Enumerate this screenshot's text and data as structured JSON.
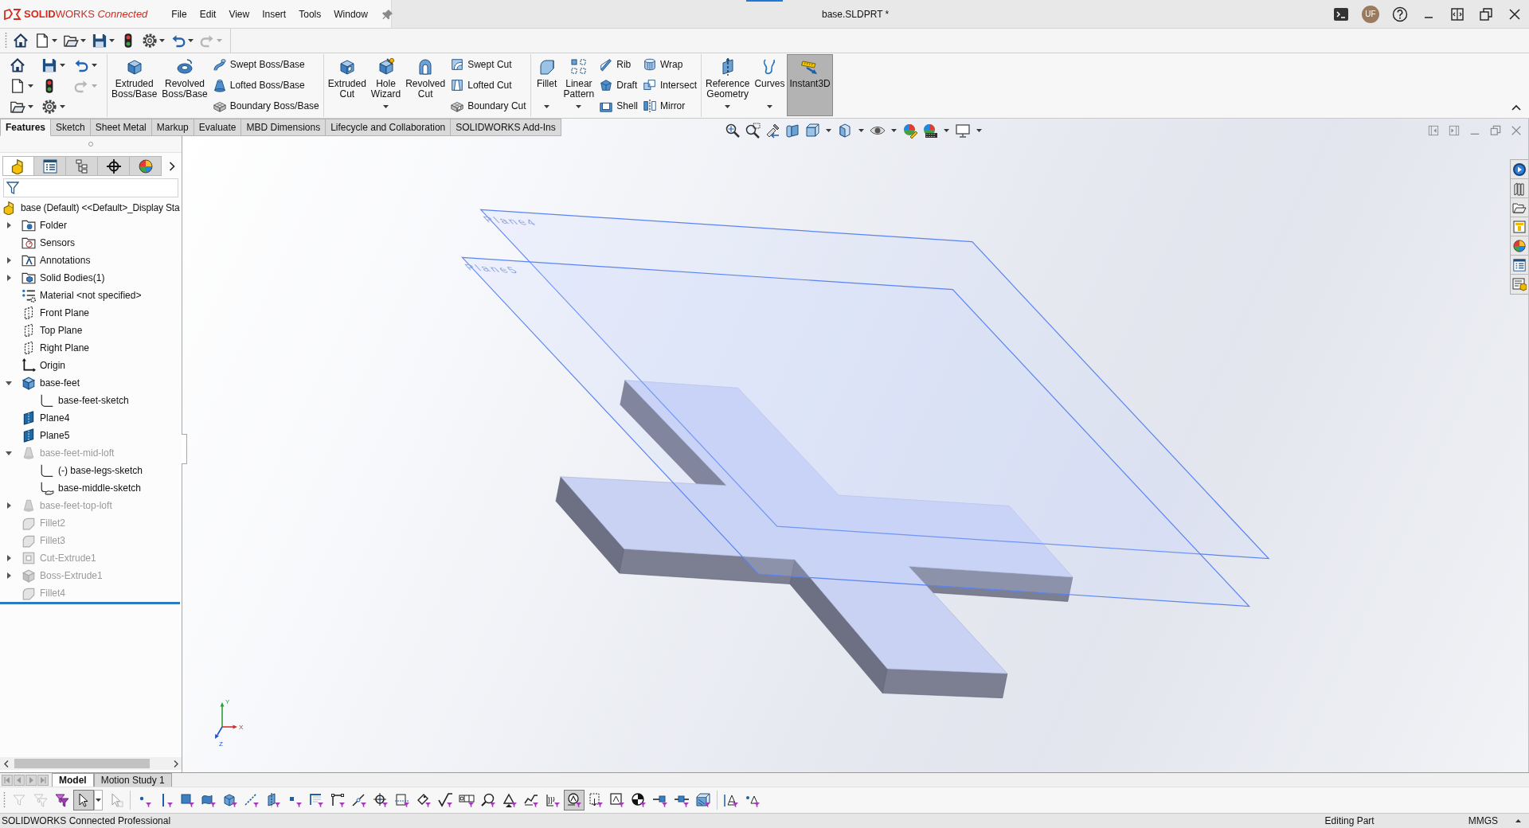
{
  "title_bar": {
    "brand": "**SOLID**WORKS *Connected*",
    "menus": [
      "File",
      "Edit",
      "View",
      "Insert",
      "Tools",
      "Window"
    ],
    "document": "base.SLDPRT *",
    "user_initials": "UF"
  },
  "quick_access_toolbar": [
    {
      "disabled": false
    },
    {
      "disabled": false
    },
    {
      "disabled": false
    },
    {
      "disabled": false
    },
    {
      "disabled": false
    },
    {
      "disabled": false
    },
    {
      "disabled": false
    },
    {
      "disabled": true
    }
  ],
  "command_manager": {
    "quick_tools": [
      {
        "disabled": false
      },
      {
        "disabled": false
      },
      {
        "disabled": false
      },
      {
        "disabled": false
      },
      {
        "disabled": false
      },
      {
        "disabled": true
      },
      {
        "disabled": false
      },
      {
        "disabled": false
      }
    ],
    "groups": [
      {
        "items": [
          {
            "kind": "large",
            "label": "Extruded Boss/Base",
            "dropdown": false,
            "selected": false
          },
          {
            "kind": "large",
            "label": "Revolved Boss/Base",
            "dropdown": false,
            "selected": false
          },
          {
            "kind": "stack",
            "buttons": [
              {
                "label": "Swept Boss/Base"
              },
              {
                "label": "Lofted Boss/Base"
              },
              {
                "label": "Boundary Boss/Base"
              }
            ]
          }
        ]
      },
      {
        "items": [
          {
            "kind": "large",
            "label": "Extruded Cut",
            "dropdown": false,
            "selected": false
          },
          {
            "kind": "large",
            "label": "Hole Wizard",
            "dropdown": true,
            "selected": false
          },
          {
            "kind": "large",
            "label": "Revolved Cut",
            "dropdown": false,
            "selected": false
          },
          {
            "kind": "stack",
            "buttons": [
              {
                "label": "Swept Cut"
              },
              {
                "label": "Lofted Cut"
              },
              {
                "label": "Boundary Cut"
              }
            ]
          }
        ]
      },
      {
        "items": [
          {
            "kind": "large",
            "label": "Fillet",
            "dropdown": true,
            "selected": false
          },
          {
            "kind": "large",
            "label": "Linear Pattern",
            "dropdown": true,
            "selected": false
          },
          {
            "kind": "stack",
            "buttons": [
              {
                "label": "Rib"
              },
              {
                "label": "Draft"
              },
              {
                "label": "Shell"
              }
            ]
          },
          {
            "kind": "stack",
            "buttons": [
              {
                "label": "Wrap"
              },
              {
                "label": "Intersect"
              },
              {
                "label": "Mirror"
              }
            ]
          }
        ]
      },
      {
        "items": [
          {
            "kind": "large",
            "label": "Reference Geometry",
            "dropdown": true,
            "selected": false
          },
          {
            "kind": "large",
            "label": "Curves",
            "dropdown": true,
            "selected": false
          },
          {
            "kind": "large",
            "label": "Instant3D",
            "dropdown": false,
            "selected": true
          }
        ]
      }
    ]
  },
  "command_tabs": [
    {
      "label": "Features",
      "selected": true
    },
    {
      "label": "Sketch",
      "selected": false
    },
    {
      "label": "Sheet Metal",
      "selected": false
    },
    {
      "label": "Markup",
      "selected": false
    },
    {
      "label": "Evaluate",
      "selected": false
    },
    {
      "label": "MBD Dimensions",
      "selected": false
    },
    {
      "label": "Lifecycle and Collaboration",
      "selected": false
    },
    {
      "label": "SOLIDWORKS Add-Ins",
      "selected": false
    }
  ],
  "feature_manager": {
    "tabs": [
      {
        "selected": true
      },
      {
        "selected": false
      },
      {
        "selected": false
      },
      {
        "selected": false
      },
      {
        "selected": false
      }
    ],
    "tree": {
      "root": {
        "label": "base (Default) <<Default>_Display Sta",
        "kind": "part"
      },
      "items": [
        {
          "label": "Folder",
          "kind": "folder",
          "expanded": false,
          "suppressed": false
        },
        {
          "label": "Sensors",
          "kind": "sensors",
          "suppressed": false
        },
        {
          "label": "Annotations",
          "kind": "annotations",
          "expanded": false,
          "suppressed": false
        },
        {
          "label": "Solid Bodies(1)",
          "kind": "bodies",
          "expanded": false,
          "suppressed": false
        },
        {
          "label": "Material <not specified>",
          "kind": "material",
          "suppressed": false
        },
        {
          "label": "Front Plane",
          "kind": "plane",
          "suppressed": false
        },
        {
          "label": "Top Plane",
          "kind": "plane",
          "suppressed": false
        },
        {
          "label": "Right Plane",
          "kind": "plane",
          "suppressed": false
        },
        {
          "label": "Origin",
          "kind": "origin",
          "suppressed": false
        },
        {
          "label": "base-feet",
          "kind": "extrude",
          "expanded": true,
          "suppressed": false,
          "children": [
            {
              "label": "base-feet-sketch",
              "kind": "sketch",
              "suppressed": false
            }
          ]
        },
        {
          "label": "Plane4",
          "kind": "ref_plane",
          "suppressed": false
        },
        {
          "label": "Plane5",
          "kind": "ref_plane",
          "suppressed": false
        },
        {
          "label": "base-feet-mid-loft",
          "kind": "loft",
          "expanded": true,
          "suppressed": true,
          "children": [
            {
              "label": "(-) base-legs-sketch",
              "kind": "sketch",
              "suppressed": false
            },
            {
              "label": "base-middle-sketch",
              "kind": "shared_sketch",
              "suppressed": false
            }
          ]
        },
        {
          "label": "base-feet-top-loft",
          "kind": "loft",
          "expanded": false,
          "suppressed": true
        },
        {
          "label": "Fillet2",
          "kind": "fillet",
          "suppressed": true
        },
        {
          "label": "Fillet3",
          "kind": "fillet",
          "suppressed": true
        },
        {
          "label": "Cut-Extrude1",
          "kind": "cut",
          "expanded": false,
          "suppressed": true
        },
        {
          "label": "Boss-Extrude1",
          "kind": "extrude",
          "expanded": false,
          "suppressed": true
        },
        {
          "label": "Fillet4",
          "kind": "fillet",
          "suppressed": true
        }
      ]
    }
  },
  "graphics": {
    "planes": [
      {
        "label": "Plane4"
      },
      {
        "label": "Plane5"
      }
    ],
    "triad": {
      "x": "X",
      "y": "Y",
      "z": "Z"
    }
  },
  "study_tabs": [
    {
      "label": "Model",
      "selected": true
    },
    {
      "label": "Motion Study 1",
      "selected": false
    }
  ],
  "selection_filter": [
    {
      "disabled": true,
      "selected": false
    },
    {
      "disabled": true,
      "selected": false
    },
    {
      "disabled": false,
      "selected": false
    },
    {
      "disabled": false,
      "selected": true
    },
    {
      "disabled": true,
      "selected": false
    },
    {
      "disabled": false,
      "selected": false
    },
    {
      "disabled": false,
      "selected": false
    },
    {
      "disabled": false,
      "selected": false
    },
    {
      "disabled": false,
      "selected": false
    },
    {
      "disabled": false,
      "selected": false
    },
    {
      "disabled": false,
      "selected": false
    },
    {
      "disabled": false,
      "selected": false
    },
    {
      "disabled": false,
      "selected": false
    },
    {
      "disabled": false,
      "selected": false
    },
    {
      "disabled": false,
      "selected": false
    },
    {
      "disabled": false,
      "selected": false
    },
    {
      "disabled": false,
      "selected": false
    },
    {
      "disabled": false,
      "selected": false
    },
    {
      "disabled": false,
      "selected": false
    },
    {
      "disabled": false,
      "selected": false
    },
    {
      "disabled": false,
      "selected": false
    },
    {
      "disabled": false,
      "selected": false
    },
    {
      "disabled": false,
      "selected": false
    },
    {
      "disabled": false,
      "selected": false
    },
    {
      "disabled": false,
      "selected": false
    },
    {
      "disabled": false,
      "selected": true
    },
    {
      "disabled": false,
      "selected": false
    },
    {
      "disabled": false,
      "selected": false
    },
    {
      "disabled": false,
      "selected": false
    },
    {
      "disabled": false,
      "selected": false
    },
    {
      "disabled": false,
      "selected": false
    },
    {
      "disabled": false,
      "selected": false
    },
    {
      "disabled": false,
      "selected": false
    },
    {
      "disabled": false,
      "selected": false
    }
  ],
  "status_bar": {
    "product": "SOLIDWORKS Connected Professional",
    "mode": "Editing Part",
    "units": "MMGS"
  }
}
